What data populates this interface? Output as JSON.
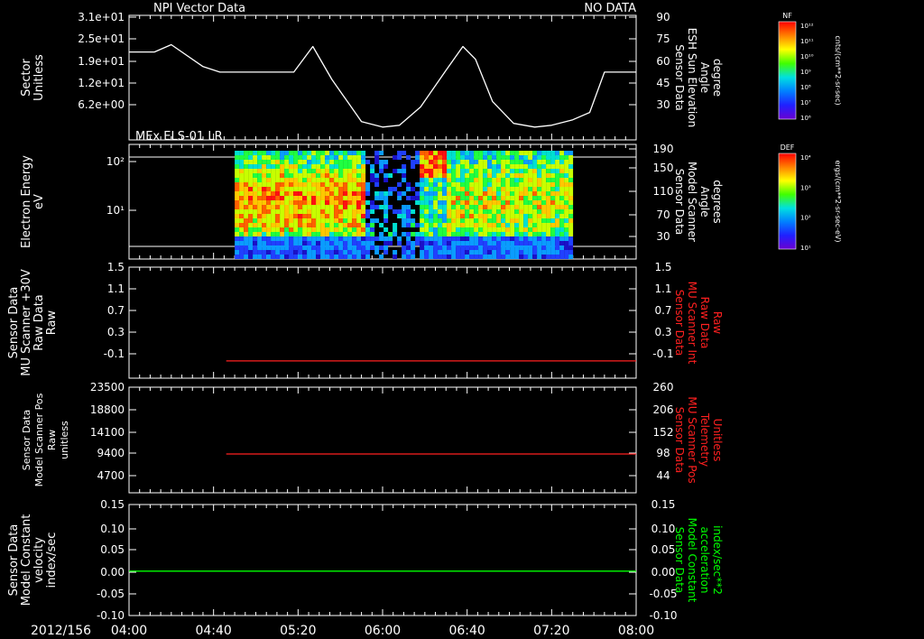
{
  "top_left_title": "NPI Vector Data",
  "top_right_status": "NO DATA",
  "panel2_title": "MEx ELS-01 LR",
  "date_label": "2012/156",
  "time_ticks": [
    "04:00",
    "04:40",
    "05:20",
    "06:00",
    "06:40",
    "07:20",
    "08:00"
  ],
  "colorbars": [
    {
      "tag": "NF",
      "units": "cnts/(cm**2-sr-sec)",
      "labels": [
        "10¹²",
        "10¹¹",
        "10¹⁰",
        "10⁹",
        "10⁸",
        "10⁷",
        "10⁶"
      ]
    },
    {
      "tag": "DEF",
      "units": "ergs/(cm**2-sr-sec-eV)",
      "labels": [
        "10⁴",
        "10³",
        "10²",
        "10¹"
      ]
    }
  ],
  "panels": [
    {
      "left_label": [
        "Sector",
        "Unitless"
      ],
      "left_color": "#ffffff",
      "right_label": [
        "Sensor Data",
        "ESH Sun Elevation",
        "Angle",
        "degree"
      ],
      "right_color": "#ffffff",
      "left_ticks": [
        "3.1e+01",
        "2.5e+01",
        "1.9e+01",
        "1.2e+01",
        "6.2e+00"
      ],
      "right_ticks": [
        "90",
        "75",
        "60",
        "45",
        "30"
      ]
    },
    {
      "left_label": [
        "Electron Energy",
        "eV"
      ],
      "left_color": "#ffffff",
      "right_label": [
        "Sensor Data",
        "Model Scanner",
        "Angle",
        "degrees"
      ],
      "right_color": "#ffffff",
      "left_ticks": [
        "10²",
        "10¹"
      ],
      "right_ticks": [
        "190",
        "150",
        "110",
        "70",
        "30"
      ]
    },
    {
      "left_label": [
        "Sensor Data",
        "MU Scanner +30V",
        "Raw Data",
        "Raw"
      ],
      "left_color": "#ffffff",
      "right_label": [
        "Sensor Data",
        "MU Scanner Int",
        "Raw Data",
        "Raw"
      ],
      "right_color": "#ff2020",
      "left_ticks": [
        "1.5",
        "1.1",
        "0.7",
        "0.3",
        "-0.1"
      ],
      "right_ticks": [
        "1.5",
        "1.1",
        "0.7",
        "0.3",
        "-0.1"
      ]
    },
    {
      "left_label": [
        "Sensor Data",
        "Model Scanner Pos",
        "Raw",
        "unitless"
      ],
      "left_color": "#ffffff",
      "right_label": [
        "Sensor Data",
        "MU Scanner Pos",
        "Telemetry",
        "Unitless"
      ],
      "right_color": "#ff2020",
      "left_ticks": [
        "23500",
        "18800",
        "14100",
        "9400",
        "4700"
      ],
      "right_ticks": [
        "260",
        "206",
        "152",
        "98",
        "44"
      ]
    },
    {
      "left_label": [
        "Sensor Data",
        "Model Constant",
        "velocity",
        "index/sec"
      ],
      "left_color": "#ffffff",
      "right_label": [
        "Sensor Data",
        "Model Constant",
        "acceleration",
        "index/sec**2"
      ],
      "right_color": "#00ff00",
      "left_ticks": [
        "0.15",
        "0.10",
        "0.05",
        "0.00",
        "-0.05",
        "-0.10"
      ],
      "right_ticks": [
        "0.15",
        "0.10",
        "0.05",
        "0.00",
        "-0.05",
        "-0.10"
      ]
    }
  ],
  "chart_data": [
    {
      "type": "line",
      "panel": 1,
      "series": [
        {
          "axis": "right",
          "x": [
            "04:00",
            "04:12",
            "04:20",
            "04:35",
            "04:43",
            "05:05",
            "05:18",
            "05:27",
            "05:36",
            "05:50",
            "06:00",
            "06:08",
            "06:18",
            "06:30",
            "06:38",
            "06:44",
            "06:52",
            "07:02",
            "07:12",
            "07:20",
            "07:30",
            "07:38",
            "07:45",
            "08:00"
          ],
          "y": [
            70,
            70,
            74,
            62,
            59,
            59,
            59,
            73,
            55,
            32,
            29,
            30,
            40,
            60,
            73,
            66,
            43,
            31,
            29,
            30,
            33,
            37,
            59,
            59
          ]
        }
      ],
      "ylim": [
        22,
        90
      ],
      "color": "#ffffff"
    },
    {
      "type": "heatmap",
      "panel": 2,
      "note_text": "",
      "x_range": [
        "04:50",
        "07:29"
      ],
      "y_scale": "log",
      "ylim": [
        1.3,
        180
      ]
    },
    {
      "type": "line",
      "panel": 3,
      "series": [
        {
          "axis": "right",
          "x": [
            "04:46",
            "08:00"
          ],
          "y": [
            -0.02,
            -0.02
          ]
        }
      ],
      "ylim": [
        -0.3,
        1.5
      ],
      "color": "#ff2020"
    },
    {
      "type": "line",
      "panel": 4,
      "series": [
        {
          "axis": "right",
          "x": [
            "04:46",
            "08:00"
          ],
          "y": [
            98,
            98
          ]
        }
      ],
      "ylim": [
        4,
        260
      ],
      "color": "#ff2020"
    },
    {
      "type": "line",
      "panel": 5,
      "series": [
        {
          "axis": "right",
          "x": [
            "04:00",
            "08:00"
          ],
          "y": [
            0.0,
            0.0
          ]
        }
      ],
      "ylim": [
        -0.1,
        0.15
      ],
      "color": "#00ff00"
    }
  ]
}
